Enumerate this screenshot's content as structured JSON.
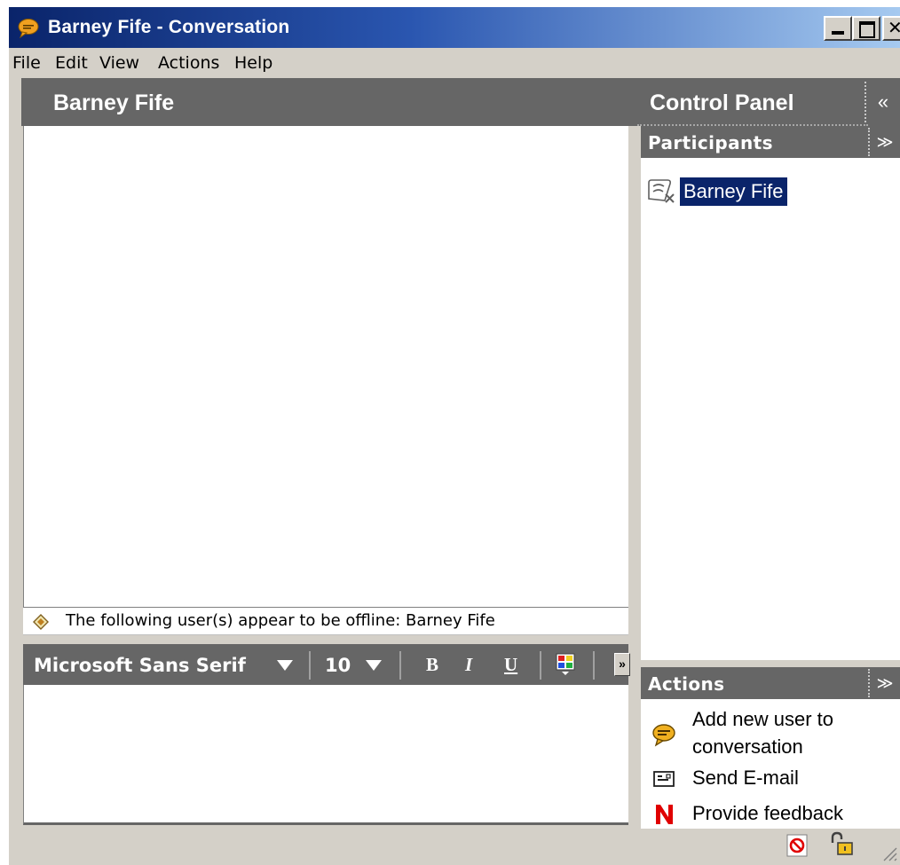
{
  "window": {
    "title": "Barney Fife - Conversation"
  },
  "menu": {
    "file": "File",
    "edit": "Edit",
    "view": "View",
    "actions": "Actions",
    "help": "Help"
  },
  "conversation": {
    "header": "Barney Fife",
    "offline_notice": "The following user(s) appear to be offline: Barney Fife"
  },
  "format_toolbar": {
    "font_name": "Microsoft Sans Serif",
    "font_size": "10",
    "bold": "B",
    "italic": "I",
    "underline": "U",
    "more": "»"
  },
  "control_panel": {
    "title": "Control Panel",
    "collapse": "«",
    "participants": {
      "heading": "Participants",
      "toggle": "≫",
      "items": [
        {
          "name": "Barney Fife",
          "icon": "offline-user-icon",
          "selected": true
        }
      ]
    },
    "actions": {
      "heading": "Actions",
      "toggle": "≫",
      "items": [
        {
          "label_line1": "Add new user to",
          "label_line2": "conversation",
          "icon": "chat-bubble-icon"
        },
        {
          "label": "Send E-mail",
          "icon": "email-icon"
        },
        {
          "label": "Provide feedback",
          "icon": "novell-n-icon"
        }
      ]
    }
  },
  "colors": {
    "titlebar_start": "#0a246a",
    "titlebar_end": "#a6caf0",
    "panel_header": "#666666",
    "selection": "#0a246a",
    "window_bg": "#d4d0c8",
    "novell_red": "#e00000"
  }
}
